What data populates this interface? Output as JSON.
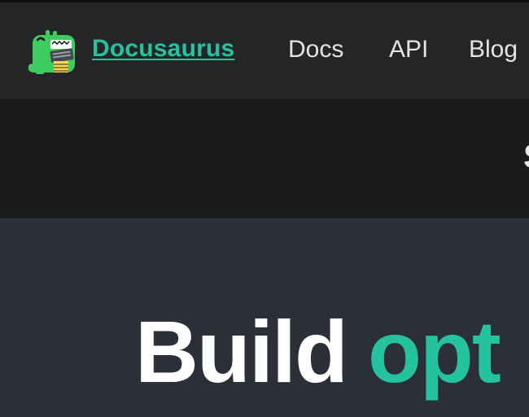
{
  "colors": {
    "accent": "#25c2a0",
    "navbar_bg": "#242526",
    "banner_bg": "#1b1b1d",
    "hero_bg": "#2b2f37"
  },
  "navbar": {
    "logo_icon": "docusaurus-dinosaur-logo",
    "brand": "Docusaurus",
    "links": [
      "Docs",
      "API",
      "Blog"
    ]
  },
  "banner": {
    "text": "S"
  },
  "hero": {
    "title_word1": "Build",
    "title_word2": "opt"
  }
}
